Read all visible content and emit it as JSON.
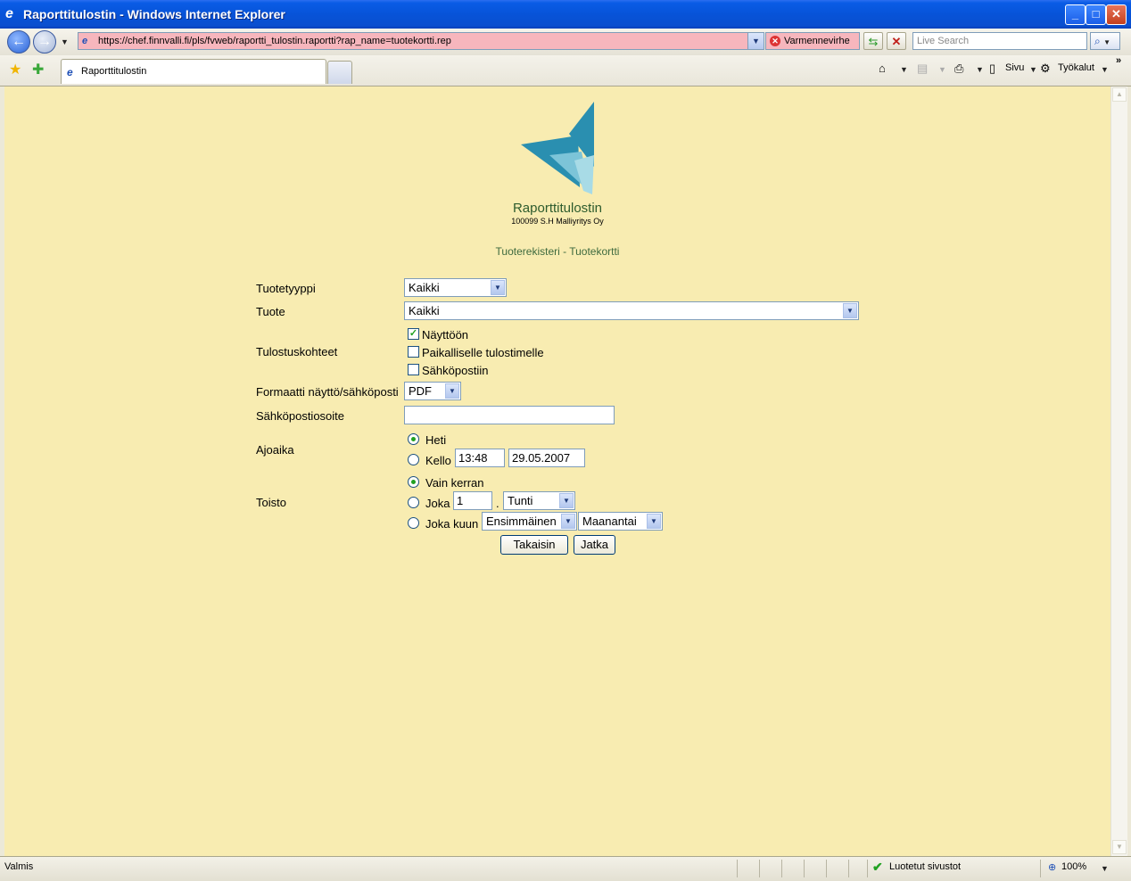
{
  "window": {
    "title": "Raporttitulostin - Windows Internet Explorer",
    "minimize": "_",
    "maximize": "□",
    "close": "✕"
  },
  "addressbar": {
    "url": "https://chef.finnvalli.fi/pls/fvweb/raportti_tulostin.raportti?rap_name=tuotekortti.rep",
    "cert_error": "Varmennevirhe",
    "search_placeholder": "Live Search"
  },
  "tabs": [
    {
      "label": "Raporttitulostin"
    }
  ],
  "commandbar": {
    "page_label": "Sivu",
    "tools_label": "Työkalut"
  },
  "page": {
    "app_title": "Raporttitulostin",
    "company": "100099 S.H Malliyritys Oy",
    "report_name": "Tuoterekisteri - Tuotekortti",
    "form": {
      "product_type": {
        "label": "Tuotetyyppi",
        "value": "Kaikki"
      },
      "product": {
        "label": "Tuote",
        "value": "Kaikki"
      },
      "targets": {
        "label": "Tulostuskohteet",
        "options": [
          {
            "label": "Näyttöön",
            "checked": true
          },
          {
            "label": "Paikalliselle tulostimelle",
            "checked": false
          },
          {
            "label": "Sähköpostiin",
            "checked": false
          }
        ]
      },
      "format": {
        "label": "Formaatti näyttö/sähköposti",
        "value": "PDF"
      },
      "email": {
        "label": "Sähköpostiosoite",
        "value": ""
      },
      "runtime": {
        "label": "Ajoaika",
        "now_label": "Heti",
        "at_label": "Kello",
        "time": "13:48",
        "date": "29.05.2007",
        "selected": "now"
      },
      "repeat": {
        "label": "Toisto",
        "once_label": "Vain kerran",
        "every_label": "Joka",
        "every_value": "1",
        "separator": ".",
        "every_unit": "Tunti",
        "monthly_label": "Joka kuun",
        "monthly_ordinal": "Ensimmäinen",
        "monthly_day": "Maanantai",
        "selected": "once"
      },
      "back_button": "Takaisin",
      "continue_button": "Jatka"
    }
  },
  "statusbar": {
    "status": "Valmis",
    "zone": "Luotetut sivustot",
    "zoom": "100%"
  },
  "colors": {
    "page_background": "#f8ecb1",
    "title_green": "#2e5c2e",
    "logo_teal": "#2a8fb0",
    "url_error": "#f7b6bd"
  }
}
